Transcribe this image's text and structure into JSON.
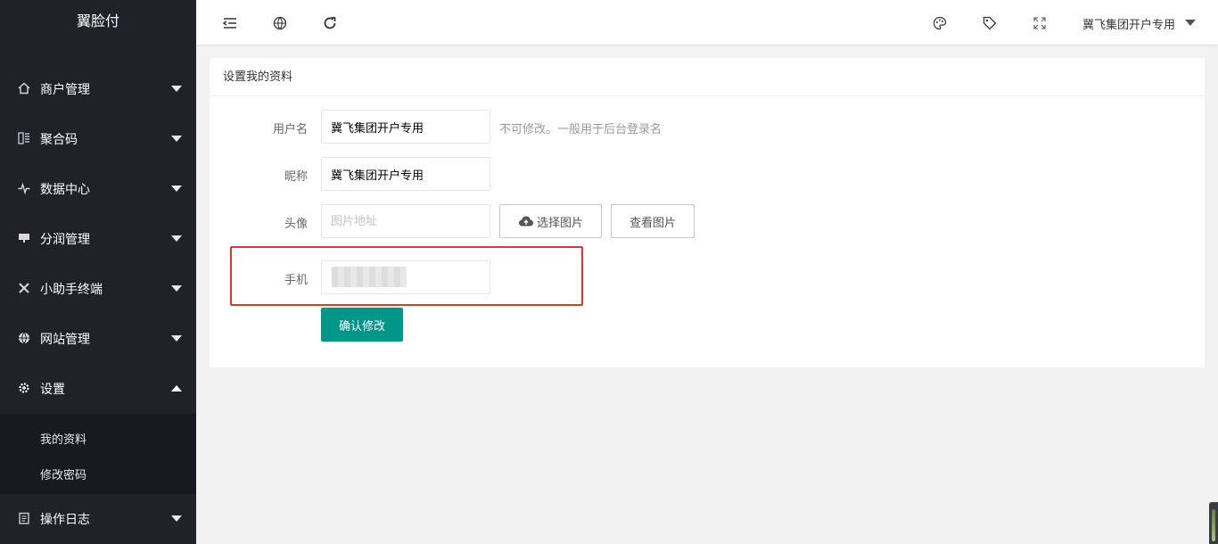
{
  "sidebar": {
    "logo": "翼脸付",
    "items": [
      {
        "label": "商户管理",
        "icon": "home-icon"
      },
      {
        "label": "聚合码",
        "icon": "qrcode-icon"
      },
      {
        "label": "数据中心",
        "icon": "chart-pulse-icon"
      },
      {
        "label": "分润管理",
        "icon": "monitor-icon"
      },
      {
        "label": "小助手终端",
        "icon": "tools-icon"
      },
      {
        "label": "网站管理",
        "icon": "globe-icon"
      },
      {
        "label": "设置",
        "icon": "gear-icon"
      },
      {
        "label": "操作日志",
        "icon": "clipboard-icon"
      }
    ],
    "sub_items": [
      {
        "label": "我的资料"
      },
      {
        "label": "修改密码"
      }
    ]
  },
  "header": {
    "user_name": "冀飞集团开户专用",
    "icons": [
      "menu-collapse-icon",
      "globe-icon",
      "refresh-icon",
      "theme-palette-icon",
      "tag-icon",
      "fullscreen-icon"
    ]
  },
  "card": {
    "title": "设置我的资料",
    "username": {
      "label": "用户名",
      "value": "冀飞集团开户专用",
      "hint": "不可修改。一般用于后台登录名"
    },
    "nickname": {
      "label": "昵称",
      "value": "冀飞集团开户专用"
    },
    "avatar": {
      "label": "头像",
      "placeholder": "图片地址",
      "choose_label": "选择图片",
      "view_label": "查看图片"
    },
    "phone": {
      "label": "手机",
      "value": ""
    },
    "submit_label": "确认修改"
  },
  "colors": {
    "sidebar_bg": "#20222a",
    "primary": "#009688",
    "highlight": "#e5332d"
  }
}
